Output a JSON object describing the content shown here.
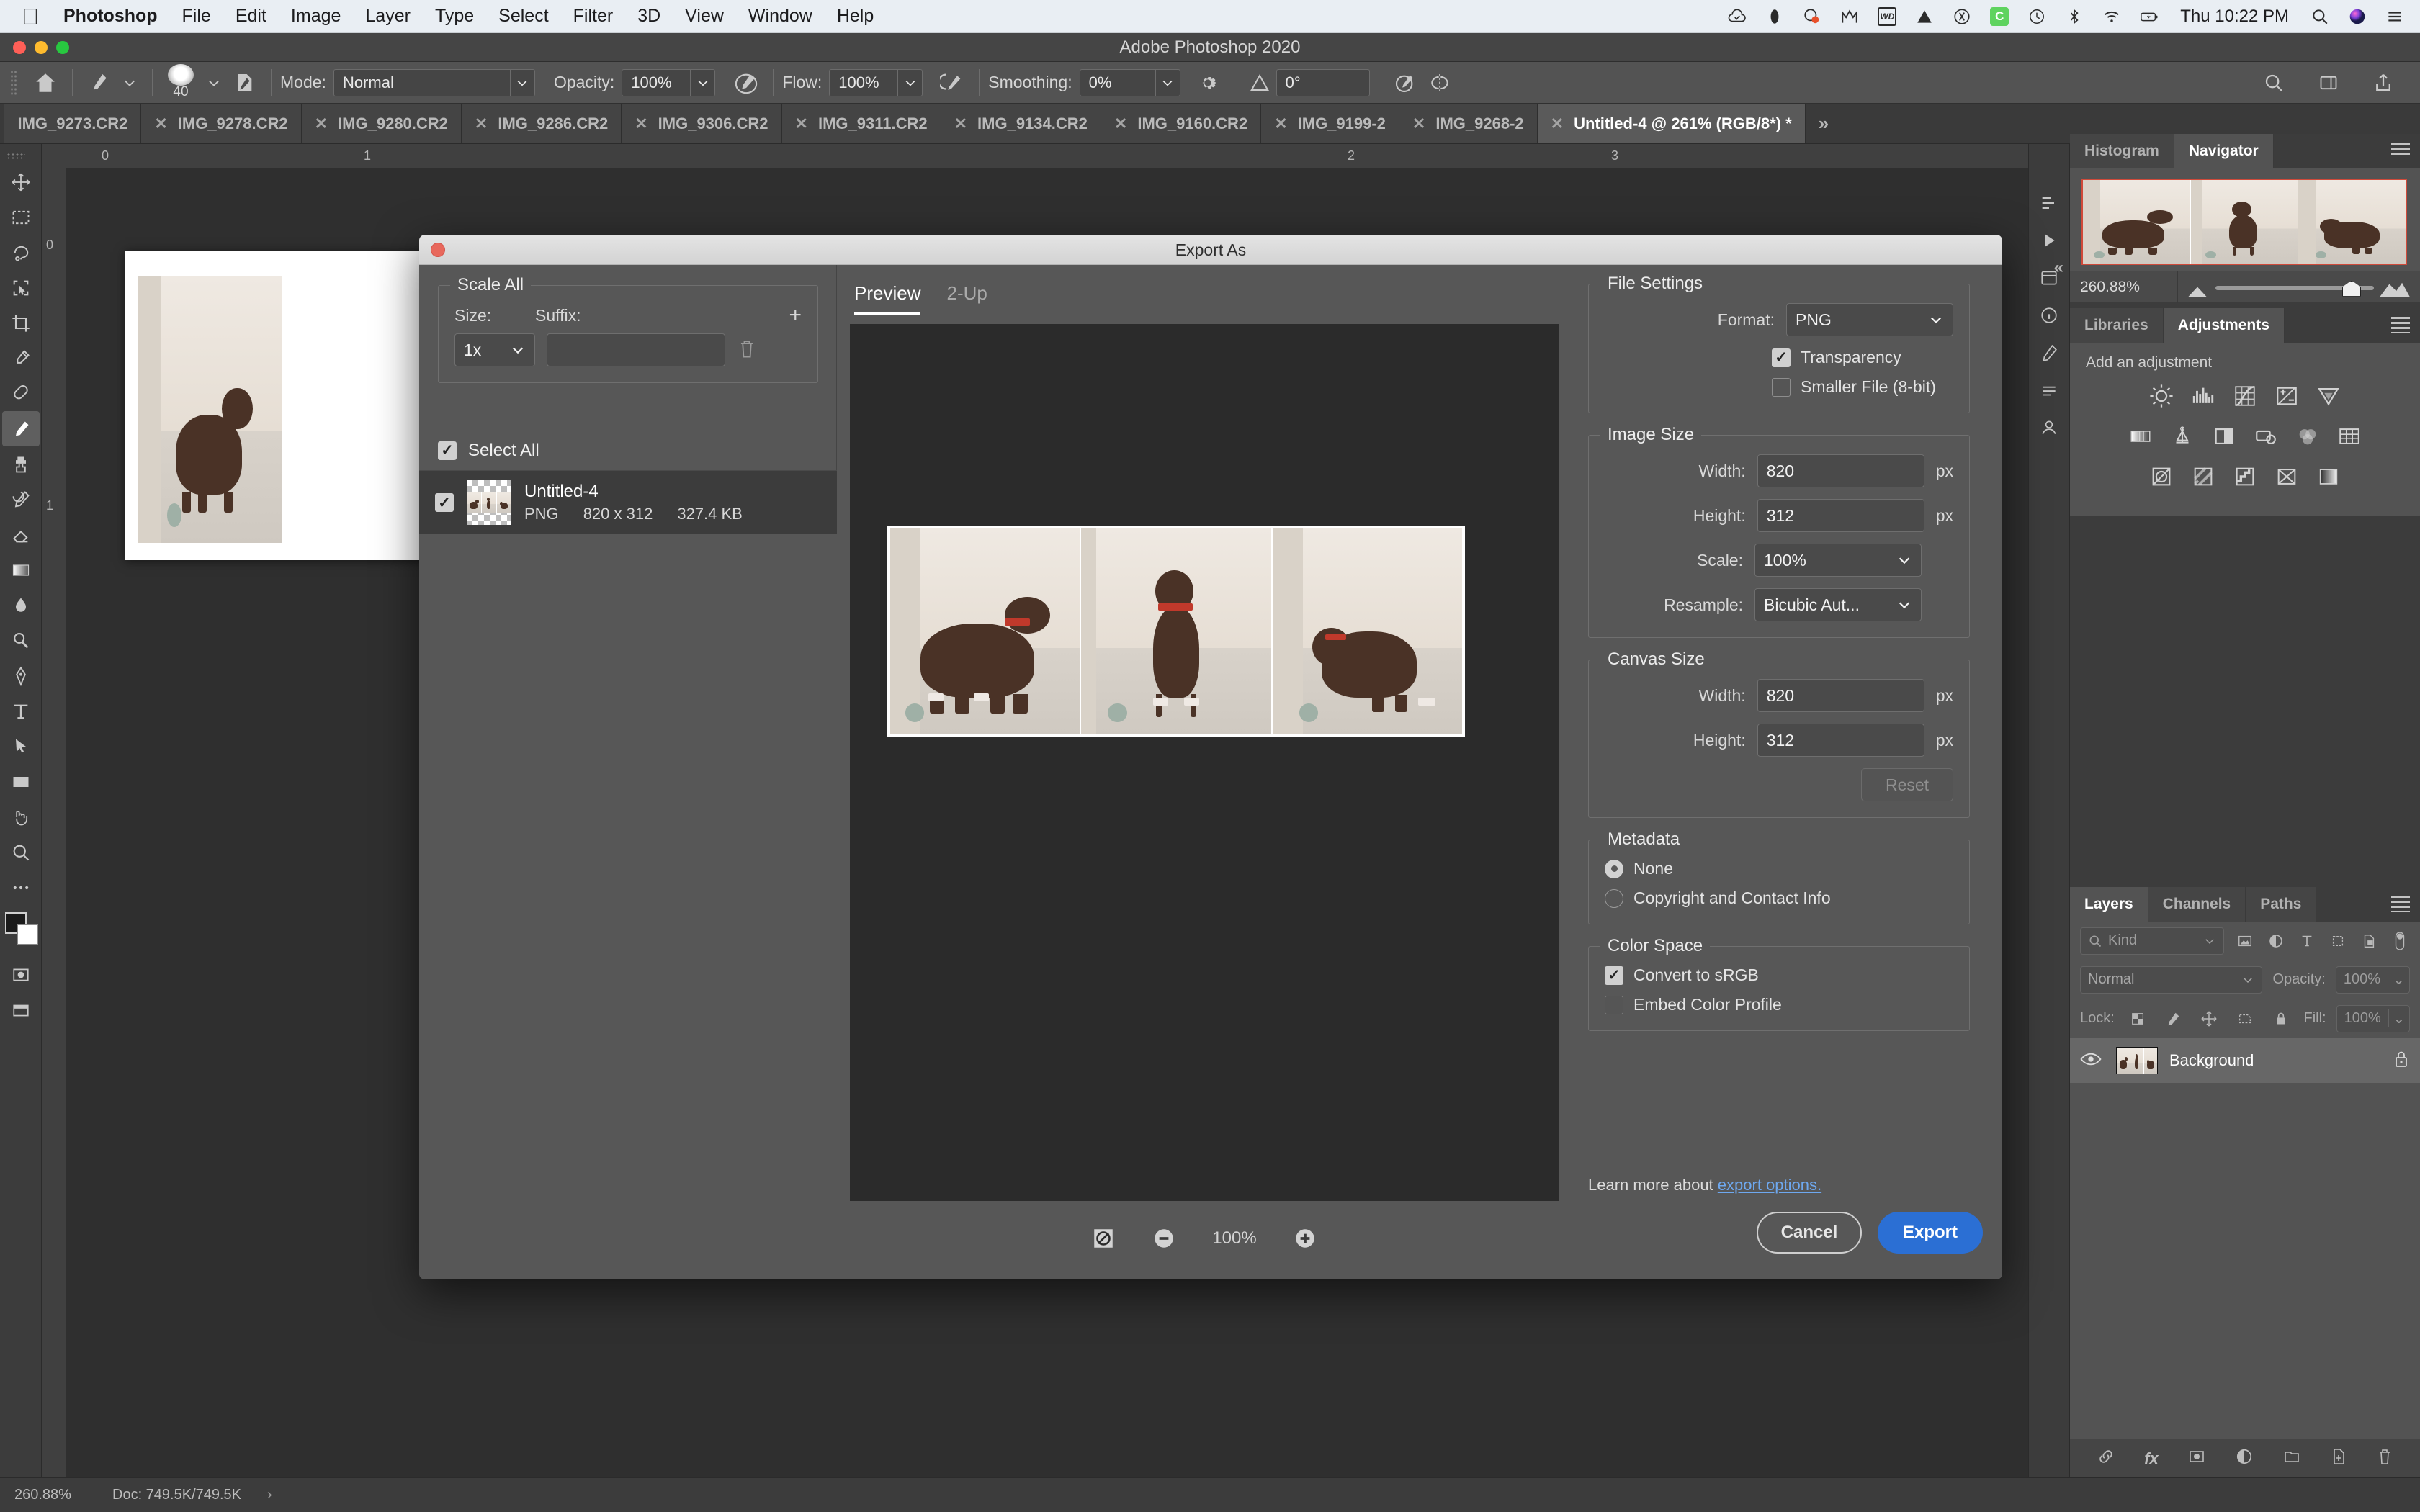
{
  "menubar": {
    "apple_icon": "apple-icon",
    "items": [
      "Photoshop",
      "File",
      "Edit",
      "Image",
      "Layer",
      "Type",
      "Select",
      "Filter",
      "3D",
      "View",
      "Window",
      "Help"
    ],
    "status_icons": [
      "creative-cloud-icon",
      "dropbox-icon",
      "malware-shield-icon",
      "malwarebytes-icon",
      "wd-drive-icon",
      "triangle-icon",
      "bluetooth-app-icon",
      "evernote-icon",
      "time-machine-icon",
      "bluetooth-icon",
      "wifi-icon",
      "battery-icon"
    ],
    "clock": "Thu 10:22 PM",
    "right_icons": [
      "search-icon",
      "siri-icon",
      "control-center-icon"
    ]
  },
  "window": {
    "title": "Adobe Photoshop 2020"
  },
  "options_bar": {
    "home_icon": "home-icon",
    "brush_preset_icon": "brush-icon",
    "brush_size": "40",
    "brush_folder_icon": "brush-settings-icon",
    "mode_label": "Mode:",
    "mode_value": "Normal",
    "opacity_label": "Opacity:",
    "opacity_value": "100%",
    "pressure_opacity_icon": "pressure-opacity-icon",
    "flow_label": "Flow:",
    "flow_value": "100%",
    "airbrush_icon": "airbrush-icon",
    "smoothing_label": "Smoothing:",
    "smoothing_value": "0%",
    "smoothing_gear_icon": "gear-icon",
    "angle_icon": "angle-icon",
    "angle_value": "0°",
    "pressure_size_icon": "pressure-size-icon",
    "symmetry_icon": "symmetry-icon",
    "right_icons": [
      "search-icon",
      "workspace-icon",
      "share-icon"
    ]
  },
  "tabs": {
    "overflow_left_icon": "chevron-double-left-icon",
    "items": [
      {
        "label": "IMG_9273.CR2",
        "active": false,
        "clipped": true
      },
      {
        "label": "IMG_9278.CR2",
        "active": false
      },
      {
        "label": "IMG_9280.CR2",
        "active": false
      },
      {
        "label": "IMG_9286.CR2",
        "active": false
      },
      {
        "label": "IMG_9306.CR2",
        "active": false
      },
      {
        "label": "IMG_9311.CR2",
        "active": false
      },
      {
        "label": "IMG_9134.CR2",
        "active": false
      },
      {
        "label": "IMG_9160.CR2",
        "active": false
      },
      {
        "label": "IMG_9199-2",
        "active": false
      },
      {
        "label": "IMG_9268-2",
        "active": false
      },
      {
        "label": "Untitled-4 @ 261% (RGB/8*) *",
        "active": true
      }
    ],
    "overflow_right_icon": "chevron-double-right-icon"
  },
  "toolbar": {
    "tools": [
      "move-tool-icon",
      "marquee-tool-icon",
      "lasso-tool-icon",
      "object-select-tool-icon",
      "crop-tool-icon",
      "eyedropper-tool-icon",
      "healing-brush-tool-icon",
      "brush-tool-icon",
      "clone-stamp-tool-icon",
      "history-brush-tool-icon",
      "eraser-tool-icon",
      "gradient-tool-icon",
      "blur-tool-icon",
      "dodge-tool-icon",
      "pen-tool-icon",
      "type-tool-icon",
      "path-select-tool-icon",
      "rectangle-tool-icon",
      "hand-tool-icon",
      "zoom-tool-icon",
      "more-tools-icon"
    ],
    "foreground_color": "#1b1b1b",
    "background_color": "#ffffff",
    "quick-mask-icon": "quick-mask-icon",
    "screen-mode-icon": "screen-mode-icon"
  },
  "rulers": {
    "top_ticks": [
      "0",
      "1",
      "2",
      "3"
    ],
    "left_ticks": [
      "0",
      "1"
    ]
  },
  "dialog": {
    "title": "Export As",
    "close_icon": "close-icon",
    "scale_all": {
      "legend": "Scale All",
      "size_label": "Size:",
      "suffix_label": "Suffix:",
      "size_value": "1x",
      "suffix_value": "",
      "add_icon": "plus-icon",
      "delete_icon": "trash-icon"
    },
    "select_all": {
      "label": "Select All",
      "checked": true
    },
    "file_item": {
      "checked": true,
      "name": "Untitled-4",
      "format": "PNG",
      "dimensions": "820 x 312",
      "size": "327.4 KB"
    },
    "preview": {
      "tabs": [
        {
          "label": "Preview",
          "active": true
        },
        {
          "label": "2-Up",
          "active": false
        }
      ],
      "fit_icon": "fit-to-screen-icon",
      "zoom_out_icon": "zoom-out-icon",
      "zoom_level": "100%",
      "zoom_in_icon": "zoom-in-icon"
    },
    "file_settings": {
      "legend": "File Settings",
      "format_label": "Format:",
      "format_value": "PNG",
      "transparency_label": "Transparency",
      "transparency_checked": true,
      "smaller_file_label": "Smaller File (8-bit)",
      "smaller_file_checked": false
    },
    "image_size": {
      "legend": "Image Size",
      "width_label": "Width:",
      "width_value": "820",
      "width_unit": "px",
      "height_label": "Height:",
      "height_value": "312",
      "height_unit": "px",
      "scale_label": "Scale:",
      "scale_value": "100%",
      "resample_label": "Resample:",
      "resample_value": "Bicubic Aut..."
    },
    "canvas_size": {
      "legend": "Canvas Size",
      "width_label": "Width:",
      "width_value": "820",
      "width_unit": "px",
      "height_label": "Height:",
      "height_value": "312",
      "height_unit": "px",
      "reset_label": "Reset"
    },
    "metadata": {
      "legend": "Metadata",
      "options": [
        {
          "label": "None",
          "selected": true
        },
        {
          "label": "Copyright and Contact Info",
          "selected": false
        }
      ]
    },
    "color_space": {
      "legend": "Color Space",
      "convert_label": "Convert to sRGB",
      "convert_checked": true,
      "embed_label": "Embed Color Profile",
      "embed_checked": false
    },
    "footer": {
      "learn_more_text": "Learn more about",
      "link_text": "export options.",
      "cancel_label": "Cancel",
      "export_label": "Export"
    }
  },
  "right_panels": {
    "navigator": {
      "tabs": [
        {
          "label": "Histogram",
          "active": false
        },
        {
          "label": "Navigator",
          "active": true
        }
      ],
      "menu_icon": "panel-menu-icon",
      "zoom_value": "260.88%",
      "small_thumb_icon": "small-mountain-icon",
      "large_thumb_icon": "large-mountain-icon"
    },
    "adjustments": {
      "tabs": [
        {
          "label": "Libraries",
          "active": false
        },
        {
          "label": "Adjustments",
          "active": true
        }
      ],
      "menu_icon": "panel-menu-icon",
      "hint": "Add an adjustment",
      "row1": [
        "brightness-contrast-icon",
        "levels-icon",
        "curves-icon",
        "exposure-icon",
        "vibrance-icon"
      ],
      "row2": [
        "hue-saturation-icon",
        "color-balance-icon",
        "black-white-icon",
        "photo-filter-icon",
        "channel-mixer-icon",
        "color-lookup-icon"
      ],
      "row3": [
        "invert-icon",
        "posterize-icon",
        "threshold-icon",
        "selective-color-icon",
        "gradient-map-icon"
      ]
    },
    "layers": {
      "tabs": [
        {
          "label": "Layers",
          "active": true
        },
        {
          "label": "Channels",
          "active": false
        },
        {
          "label": "Paths",
          "active": false
        }
      ],
      "menu_icon": "panel-menu-icon",
      "filter_label": "Kind",
      "filter_icons": [
        "pixel-filter-icon",
        "adjustment-filter-icon",
        "type-filter-icon",
        "shape-filter-icon",
        "smart-object-filter-icon"
      ],
      "filter_toggle_icon": "filter-toggle-icon",
      "blend_mode": "Normal",
      "opacity_label": "Opacity:",
      "opacity_value": "100%",
      "lock_label": "Lock:",
      "lock_icons": [
        "lock-transparency-icon",
        "lock-image-icon",
        "lock-position-icon",
        "lock-artboard-icon",
        "lock-all-icon"
      ],
      "fill_label": "Fill:",
      "fill_value": "100%",
      "items": [
        {
          "name": "Background",
          "visible": true,
          "locked": true
        }
      ],
      "footer_icons": [
        "link-layers-icon",
        "layer-style-icon",
        "layer-mask-icon",
        "new-fill-adjustment-icon",
        "new-group-icon",
        "new-layer-icon",
        "delete-layer-icon"
      ]
    },
    "dock_icons": [
      "history-panel-icon",
      "actions-panel-icon",
      "properties-panel-icon",
      "info-panel-icon",
      "brush-settings-panel-icon",
      "brushes-panel-icon",
      "character-panel-icon"
    ]
  },
  "status_bar": {
    "zoom": "260.88%",
    "doc_label": "Doc: 749.5K/749.5K",
    "chevron_icon": "chevron-right-icon"
  }
}
